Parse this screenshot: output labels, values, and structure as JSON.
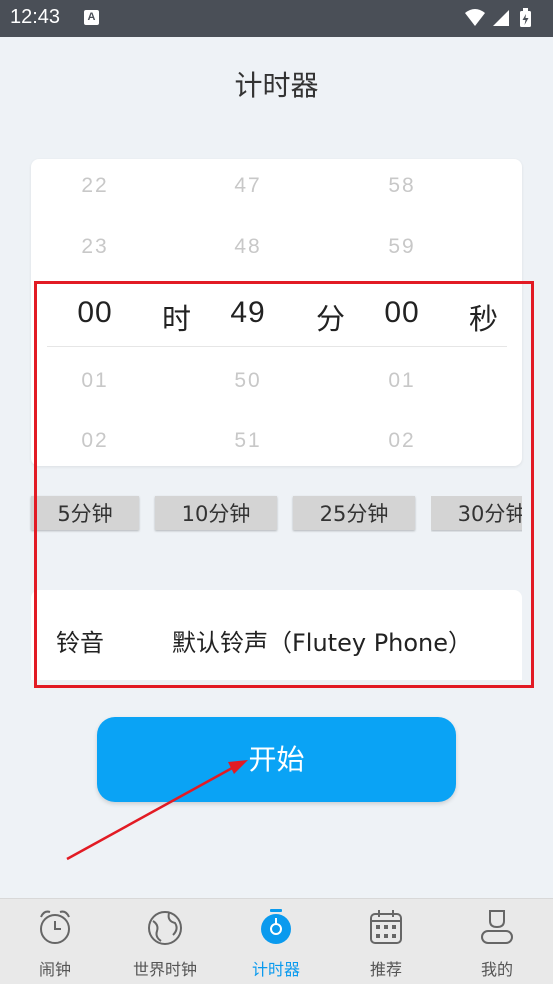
{
  "status_bar": {
    "time": "12:43",
    "notification_icon_letter": "A"
  },
  "page_title": "计时器",
  "picker": {
    "hours": {
      "above": [
        "22",
        "23"
      ],
      "selected": "00",
      "below": [
        "01",
        "02"
      ],
      "unit": "时"
    },
    "minutes": {
      "above": [
        "47",
        "48"
      ],
      "selected": "49",
      "below": [
        "50",
        "51"
      ],
      "unit": "分"
    },
    "seconds": {
      "above": [
        "58",
        "59"
      ],
      "selected": "00",
      "below": [
        "01",
        "02"
      ],
      "unit": "秒"
    }
  },
  "presets": [
    "5分钟",
    "10分钟",
    "25分钟",
    "30分钟"
  ],
  "ringtone": {
    "label": "铃音",
    "value": "默认铃声（Flutey Phone）"
  },
  "start_button": "开始",
  "bottom_nav": [
    {
      "label": "闹钟",
      "icon": "alarm-clock-icon",
      "active": false
    },
    {
      "label": "世界时钟",
      "icon": "globe-icon",
      "active": false
    },
    {
      "label": "计时器",
      "icon": "stopwatch-icon",
      "active": true
    },
    {
      "label": "推荐",
      "icon": "calendar-icon",
      "active": false
    },
    {
      "label": "我的",
      "icon": "person-icon",
      "active": false
    }
  ],
  "colors": {
    "accent": "#0aa3f5",
    "annotation_red": "#e21b24",
    "background": "#eef2f6",
    "status_bar": "#4a4f57"
  }
}
